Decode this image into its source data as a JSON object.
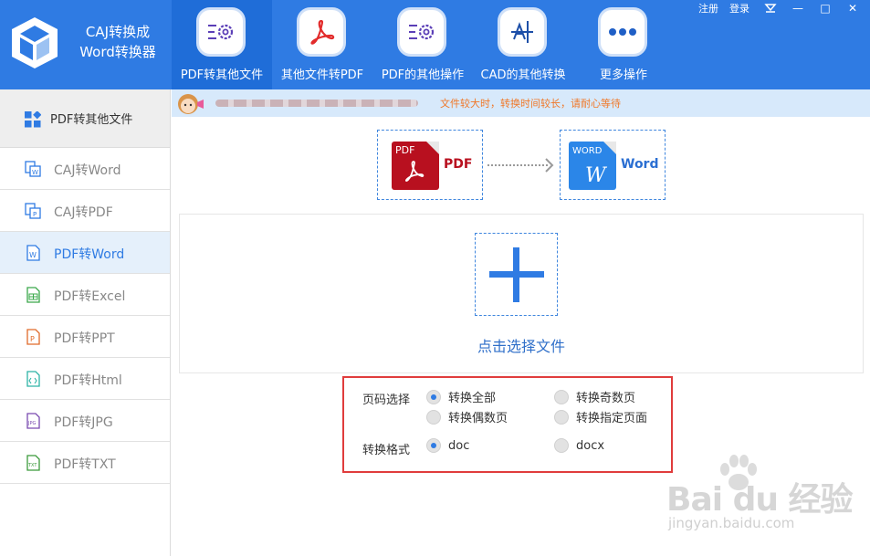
{
  "app": {
    "title_line1": "CAJ转换成",
    "title_line2": "Word转换器"
  },
  "window_controls": {
    "register": "注册",
    "login": "登录",
    "minimize": "—",
    "restore": "□",
    "close": "✕"
  },
  "toolbar": [
    {
      "label": "PDF转其他文件",
      "icon": "pdf-convert-gear-icon"
    },
    {
      "label": "其他文件转PDF",
      "icon": "acrobat-icon"
    },
    {
      "label": "PDF的其他操作",
      "icon": "pdf-settings-gear-icon"
    },
    {
      "label": "CAD的其他转换",
      "icon": "cad-drawing-icon"
    },
    {
      "label": "更多操作",
      "icon": "more-dots-icon"
    }
  ],
  "sidebar": {
    "header": "PDF转其他文件",
    "items": [
      {
        "label": "CAJ转Word",
        "icon": "caj-word-icon",
        "active": false
      },
      {
        "label": "CAJ转PDF",
        "icon": "caj-pdf-icon",
        "active": false
      },
      {
        "label": "PDF转Word",
        "icon": "word-doc-icon",
        "active": true
      },
      {
        "label": "PDF转Excel",
        "icon": "excel-doc-icon",
        "active": false
      },
      {
        "label": "PDF转PPT",
        "icon": "ppt-doc-icon",
        "active": false
      },
      {
        "label": "PDF转Html",
        "icon": "html-doc-icon",
        "active": false
      },
      {
        "label": "PDF转JPG",
        "icon": "jpg-doc-icon",
        "active": false
      },
      {
        "label": "PDF转TXT",
        "icon": "txt-doc-icon",
        "active": false
      }
    ]
  },
  "notice": {
    "text": "文件较大时，转换时间较长，请耐心等待"
  },
  "conversion": {
    "source_badge": "PDF",
    "source_label": "PDF",
    "target_badge": "WORD",
    "target_label": "Word",
    "target_letter": "W"
  },
  "upload": {
    "label": "点击选择文件"
  },
  "options": {
    "page_label": "页码选择",
    "page_options": [
      {
        "label": "转换全部",
        "checked": true
      },
      {
        "label": "转换奇数页",
        "checked": false
      },
      {
        "label": "转换偶数页",
        "checked": false
      },
      {
        "label": "转换指定页面",
        "checked": false
      }
    ],
    "format_label": "转换格式",
    "format_options": [
      {
        "label": "doc",
        "checked": true
      },
      {
        "label": "docx",
        "checked": false
      }
    ]
  },
  "watermark": {
    "brand": "Bai du 经验",
    "url": "jingyan.baidu.com"
  },
  "colors": {
    "accent": "#2f7be3",
    "highlight_border": "#e03c3c",
    "notice_text": "#f07828"
  }
}
